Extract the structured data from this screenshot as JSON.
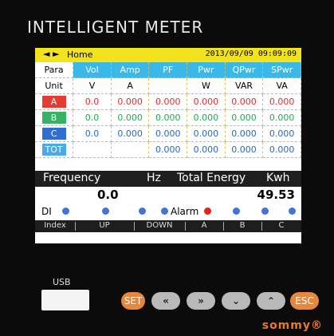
{
  "device": {
    "title": "INTELLIGENT  METER",
    "logo": "sommy®"
  },
  "topbar": {
    "nav": "◄ ►",
    "page": "Home",
    "datetime": "2013/09/09 09:09:09"
  },
  "table": {
    "headers": [
      "Para",
      "Vol",
      "Amp",
      "PF",
      "Pwr",
      "QPwr",
      "SPwr"
    ],
    "units": [
      "Unit",
      "V",
      "A",
      "",
      "W",
      "VAR",
      "VA"
    ],
    "rows": [
      {
        "phase": "A",
        "color": "#e53b33",
        "values": [
          "0.0",
          "0.000",
          "0.000",
          "0.000",
          "0.000",
          "0.000"
        ]
      },
      {
        "phase": "B",
        "color": "#37b163",
        "values": [
          "0.0",
          "0.000",
          "0.000",
          "0.000",
          "0.000",
          "0.000"
        ]
      },
      {
        "phase": "C",
        "color": "#2f6fd2",
        "values": [
          "0.0",
          "0.000",
          "0.000",
          "0.000",
          "0.000",
          "0.000"
        ]
      },
      {
        "phase": "TOT",
        "color": "#4aa9e9",
        "values": [
          "",
          "",
          "0.000",
          "0.000",
          "0.000",
          "0.000"
        ]
      }
    ]
  },
  "frequency": {
    "label": "Frequency",
    "unit": "Hz",
    "value": "0.0"
  },
  "energy": {
    "label": "Total Energy",
    "unit": "Kwh",
    "value": "49.53"
  },
  "di": {
    "label": "DI",
    "alarm": "Alarm"
  },
  "function_bar": [
    "Index",
    "UP",
    "DOWN",
    "A",
    "B",
    "C"
  ],
  "usb": {
    "label": "USB"
  },
  "keys": [
    "SET",
    "«",
    "»",
    "⌄",
    "⌃",
    "ESC"
  ],
  "colors": {
    "accent": "#e88739",
    "header": "#3bb7e8",
    "topbar": "#f2e31e"
  }
}
